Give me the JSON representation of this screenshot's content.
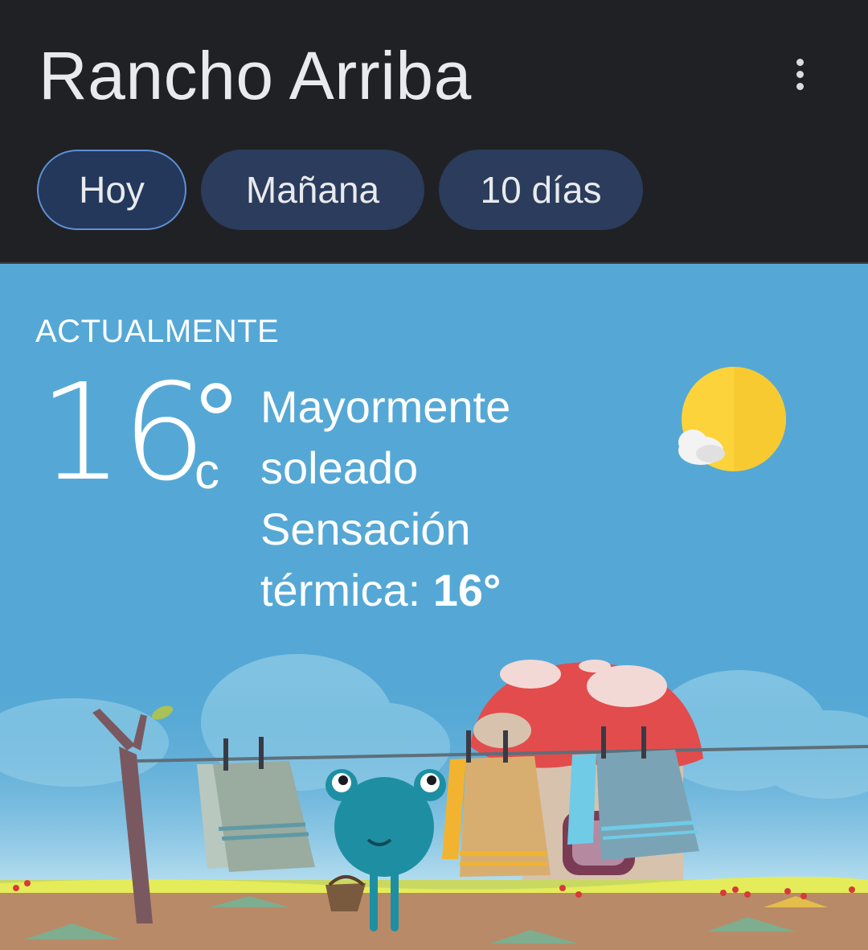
{
  "header": {
    "title": "Rancho Arriba",
    "tabs": [
      {
        "label": "Hoy",
        "active": true
      },
      {
        "label": "Mañana",
        "active": false
      },
      {
        "label": "10 días",
        "active": false
      }
    ]
  },
  "current": {
    "label": "ACTUALMENTE",
    "temperature": "16",
    "unit": "c",
    "condition_line1": "Mayormente",
    "condition_line2": "soleado",
    "feels_like_line1": "Sensación",
    "feels_like_label": "térmica:",
    "feels_like_value": "16°",
    "condition_icon": "sun-cloud-icon"
  },
  "colors": {
    "header_bg": "#202124",
    "tab_bg": "#2b3c5c",
    "tab_active_border": "#5f8fd6",
    "sky": "#55a8d5",
    "sun": "#fdd33b"
  }
}
